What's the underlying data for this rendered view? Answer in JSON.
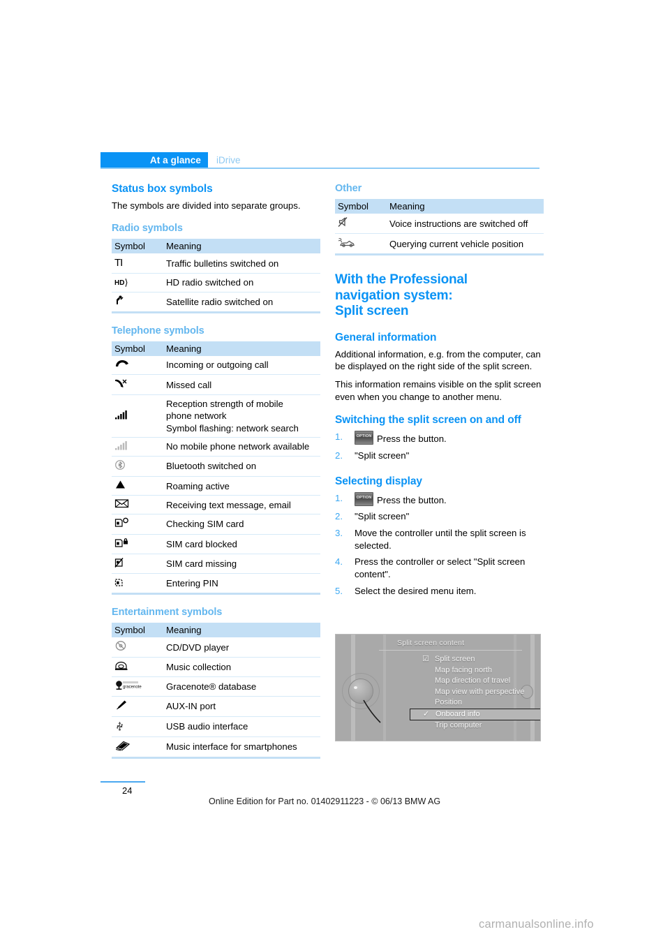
{
  "header": {
    "active_tab": "At a glance",
    "inactive_tab": "iDrive"
  },
  "left_column": {
    "status_box_heading": "Status box symbols",
    "status_box_intro": "The symbols are divided into separate groups.",
    "radio": {
      "heading": "Radio symbols",
      "col_symbol": "Symbol",
      "col_meaning": "Meaning",
      "rows": [
        {
          "icon": "traffic-bulletin-icon",
          "glyph": "TI",
          "meaning": "Traffic bulletins switched on"
        },
        {
          "icon": "hd-radio-icon",
          "glyph": "HD",
          "meaning": "HD radio switched on"
        },
        {
          "icon": "satellite-radio-icon",
          "glyph": "sat",
          "meaning": "Satellite radio switched on"
        }
      ]
    },
    "telephone": {
      "heading": "Telephone symbols",
      "col_symbol": "Symbol",
      "col_meaning": "Meaning",
      "rows": [
        {
          "icon": "phone-handset-icon",
          "meaning": "Incoming or outgoing call"
        },
        {
          "icon": "missed-call-icon",
          "meaning": "Missed call"
        },
        {
          "icon": "signal-bars-full-icon",
          "meaning": "Reception strength of mobile\nphone network\nSymbol flashing: network search"
        },
        {
          "icon": "signal-bars-empty-icon",
          "meaning": "No mobile phone network available"
        },
        {
          "icon": "bluetooth-icon",
          "meaning": "Bluetooth switched on"
        },
        {
          "icon": "roaming-triangle-icon",
          "meaning": "Roaming active"
        },
        {
          "icon": "envelope-icon",
          "meaning": "Receiving text message, email"
        },
        {
          "icon": "sim-card-checking-icon",
          "meaning": "Checking SIM card"
        },
        {
          "icon": "sim-card-blocked-icon",
          "meaning": "SIM card blocked"
        },
        {
          "icon": "sim-card-missing-icon",
          "meaning": "SIM card missing"
        },
        {
          "icon": "sim-card-pin-icon",
          "meaning": "Entering PIN"
        }
      ]
    },
    "entertainment": {
      "heading": "Entertainment symbols",
      "col_symbol": "Symbol",
      "col_meaning": "Meaning",
      "rows": [
        {
          "icon": "cd-dvd-icon",
          "meaning": "CD/DVD player"
        },
        {
          "icon": "music-collection-icon",
          "meaning": "Music collection"
        },
        {
          "icon": "gracenote-icon",
          "glyph": "gracenote",
          "meaning": "Gracenote® database"
        },
        {
          "icon": "aux-in-plug-icon",
          "meaning": "AUX-IN port"
        },
        {
          "icon": "usb-icon",
          "meaning": "USB audio interface"
        },
        {
          "icon": "smartphone-interface-icon",
          "meaning": "Music interface for smartphones"
        }
      ]
    }
  },
  "right_column": {
    "other": {
      "heading": "Other",
      "col_symbol": "Symbol",
      "col_meaning": "Meaning",
      "rows": [
        {
          "icon": "mute-speaker-icon",
          "meaning": "Voice instructions are switched off"
        },
        {
          "icon": "vehicle-position-icon",
          "meaning": "Querying current vehicle position"
        }
      ]
    },
    "big_title": "With the Professional\nnavigation system:\nSplit screen",
    "general_information": {
      "heading": "General information",
      "paragraphs": [
        "Additional information, e.g. from the computer, can be displayed on the right side of the split screen.",
        "This information remains visible on the split screen even when you change to another menu."
      ]
    },
    "switching": {
      "heading": "Switching the split screen on and off",
      "steps": [
        {
          "num": "1.",
          "button": "OPTION",
          "text": "Press the button."
        },
        {
          "num": "2.",
          "text": "\"Split screen\""
        }
      ]
    },
    "selecting": {
      "heading": "Selecting display",
      "steps": [
        {
          "num": "1.",
          "button": "OPTION",
          "text": "Press the button."
        },
        {
          "num": "2.",
          "text": "\"Split screen\""
        },
        {
          "num": "3.",
          "text": "Move the controller until the split screen is selected."
        },
        {
          "num": "4.",
          "text": "Press the controller or select \"Split screen content\"."
        },
        {
          "num": "5.",
          "text": "Select the desired menu item."
        }
      ]
    },
    "figure": {
      "title": "Split screen content",
      "items": [
        {
          "label": "Split screen",
          "mark": "☑",
          "selected": false
        },
        {
          "label": "Map facing north",
          "mark": "",
          "selected": false
        },
        {
          "label": "Map direction of travel",
          "mark": "",
          "selected": false
        },
        {
          "label": "Map view with perspective",
          "mark": "",
          "selected": false
        },
        {
          "label": "Position",
          "mark": "",
          "selected": false
        },
        {
          "label": "Onboard info",
          "mark": "✓",
          "selected": true
        },
        {
          "label": "Trip computer",
          "mark": "",
          "selected": false
        }
      ]
    }
  },
  "footer": {
    "page_number": "24",
    "edition_text": "Online Edition for Part no. 01402911223 - © 06/13 BMW AG",
    "watermark": "carmanualsonline.info"
  },
  "colors": {
    "accent_blue": "#0a93f5",
    "light_blue": "#64b7ef",
    "table_header_bg": "#c3dff5",
    "row_rule": "#d6eaf8"
  }
}
